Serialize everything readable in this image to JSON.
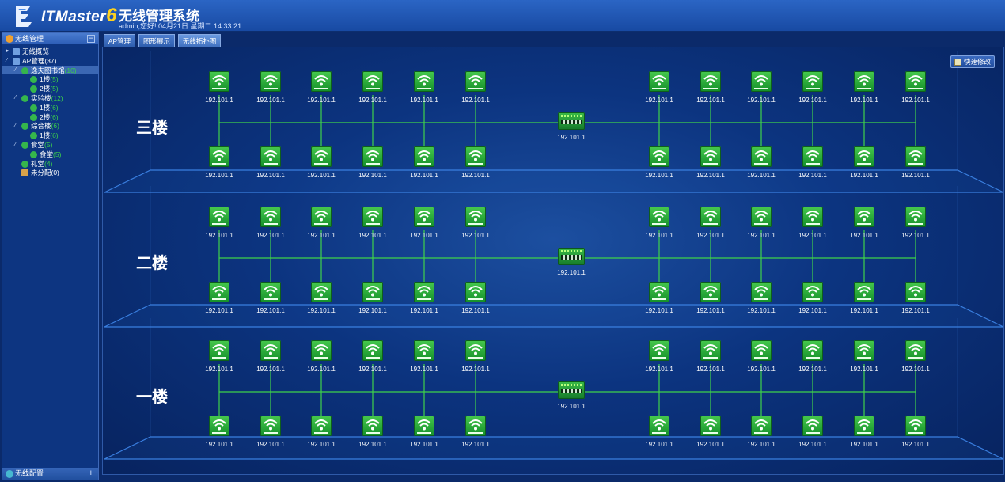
{
  "header": {
    "brand": "ITMaster",
    "brand_version": "6",
    "title": "无线管理系统",
    "subtitle": "admin,您好! 04月21日 星期二 14:33:21"
  },
  "sidebar": {
    "title": "无线管理",
    "collapse_symbol": "−",
    "footer_title": "无线配置",
    "footer_add_symbol": "+",
    "tree": [
      {
        "label": "无线概览",
        "count": "",
        "level": 0,
        "toggle": "▸",
        "icon": "overview-icon"
      },
      {
        "label": "AP管理(37)",
        "count": "",
        "level": 0,
        "toggle": "⁄",
        "icon": "ap-group-icon"
      },
      {
        "label": "逸夫图书馆",
        "count": "(10)",
        "level": 1,
        "toggle": "⁄",
        "icon": "building-icon",
        "selected": true
      },
      {
        "label": "1楼",
        "count": "(5)",
        "level": 2,
        "toggle": "",
        "icon": "floor-icon"
      },
      {
        "label": "2楼",
        "count": "(5)",
        "level": 2,
        "toggle": "",
        "icon": "floor-icon"
      },
      {
        "label": "实验楼",
        "count": "(12)",
        "level": 1,
        "toggle": "⁄",
        "icon": "building-icon"
      },
      {
        "label": "1楼",
        "count": "(6)",
        "level": 2,
        "toggle": "",
        "icon": "floor-icon"
      },
      {
        "label": "2楼",
        "count": "(6)",
        "level": 2,
        "toggle": "",
        "icon": "floor-icon"
      },
      {
        "label": "综合楼",
        "count": "(6)",
        "level": 1,
        "toggle": "⁄",
        "icon": "building-icon"
      },
      {
        "label": "1楼",
        "count": "(6)",
        "level": 2,
        "toggle": "",
        "icon": "floor-icon"
      },
      {
        "label": "食堂",
        "count": "(5)",
        "level": 1,
        "toggle": "⁄",
        "icon": "building-icon"
      },
      {
        "label": "食堂",
        "count": "(5)",
        "level": 2,
        "toggle": "",
        "icon": "floor-icon"
      },
      {
        "label": "礼堂",
        "count": "(4)",
        "level": 1,
        "toggle": "",
        "icon": "building-icon"
      },
      {
        "label": "未分配(0)",
        "count": "",
        "level": 1,
        "toggle": "",
        "icon": "unassigned-icon"
      }
    ]
  },
  "tabs": [
    {
      "label": "AP管理",
      "active": false
    },
    {
      "label": "图形展示",
      "active": false
    },
    {
      "label": "无线拓扑图",
      "active": true
    }
  ],
  "toolbar": {
    "quick_edit_label": "快速修改"
  },
  "topology": {
    "floors": [
      {
        "name": "三楼",
        "switch_ip": "192.101.1",
        "top_row_ips": [
          "192.101.1",
          "192.101.1",
          "192.101.1",
          "192.101.1",
          "192.101.1",
          "192.101.1",
          "192.101.1",
          "192.101.1",
          "192.101.1",
          "192.101.1",
          "192.101.1",
          "192.101.1"
        ],
        "bottom_row_ips": [
          "192.101.1",
          "192.101.1",
          "192.101.1",
          "192.101.1",
          "192.101.1",
          "192.101.1",
          "192.101.1",
          "192.101.1",
          "192.101.1",
          "192.101.1",
          "192.101.1",
          "192.101.1"
        ]
      },
      {
        "name": "二楼",
        "switch_ip": "192.101.1",
        "top_row_ips": [
          "192.101.1",
          "192.101.1",
          "192.101.1",
          "192.101.1",
          "192.101.1",
          "192.101.1",
          "192.101.1",
          "192.101.1",
          "192.101.1",
          "192.101.1",
          "192.101.1",
          "192.101.1"
        ],
        "bottom_row_ips": [
          "192.101.1",
          "192.101.1",
          "192.101.1",
          "192.101.1",
          "192.101.1",
          "192.101.1",
          "192.101.1",
          "192.101.1",
          "192.101.1",
          "192.101.1",
          "192.101.1",
          "192.101.1"
        ]
      },
      {
        "name": "一楼",
        "switch_ip": "192.101.1",
        "top_row_ips": [
          "192.101.1",
          "192.101.1",
          "192.101.1",
          "192.101.1",
          "192.101.1",
          "192.101.1",
          "192.101.1",
          "192.101.1",
          "192.101.1",
          "192.101.1",
          "192.101.1",
          "192.101.1"
        ],
        "bottom_row_ips": [
          "192.101.1",
          "192.101.1",
          "192.101.1",
          "192.101.1",
          "192.101.1",
          "192.101.1",
          "192.101.1",
          "192.101.1",
          "192.101.1",
          "192.101.1",
          "192.101.1",
          "192.101.1"
        ]
      }
    ]
  },
  "colors": {
    "background": "#0b2a6a",
    "ap_green": "#2fb33e",
    "link_green": "#3fd34a",
    "count_green": "#3ad14a"
  }
}
